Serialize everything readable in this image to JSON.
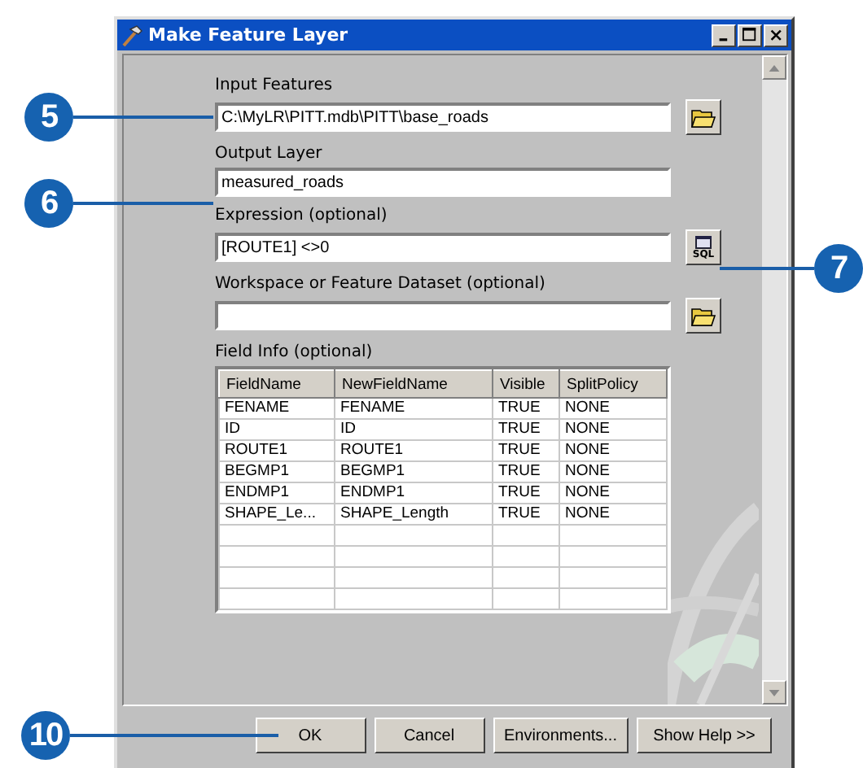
{
  "window": {
    "title": "Make Feature Layer"
  },
  "fields": [
    {
      "label": "Input Features",
      "value": "C:\\MyLR\\PITT.mdb\\PITT\\base_roads",
      "kind": "browse"
    },
    {
      "label": "Output Layer",
      "value": "measured_roads"
    },
    {
      "label": "Expression (optional)",
      "value": "[ROUTE1] <>0",
      "kind": "sql",
      "button_text": "SQL"
    },
    {
      "label": "Workspace or Feature Dataset (optional)",
      "kind": "browse"
    }
  ],
  "field_info": {
    "label": "Field Info (optional)",
    "columns": [
      "FieldName",
      "NewFieldName",
      "Visible",
      "SplitPolicy"
    ],
    "rows": [
      [
        "FENAME",
        "FENAME",
        "TRUE",
        "NONE"
      ],
      [
        "ID",
        "ID",
        "TRUE",
        "NONE"
      ],
      [
        "ROUTE1",
        "ROUTE1",
        "TRUE",
        "NONE"
      ],
      [
        "BEGMP1",
        "BEGMP1",
        "TRUE",
        "NONE"
      ],
      [
        "ENDMP1",
        "ENDMP1",
        "TRUE",
        "NONE"
      ],
      [
        "SHAPE_Le...",
        "SHAPE_Length",
        "TRUE",
        "NONE"
      ]
    ]
  },
  "buttons": [
    "OK",
    "Cancel",
    "Environments...",
    "Show Help >>"
  ],
  "callouts": [
    "5",
    "6",
    "7",
    "10"
  ]
}
